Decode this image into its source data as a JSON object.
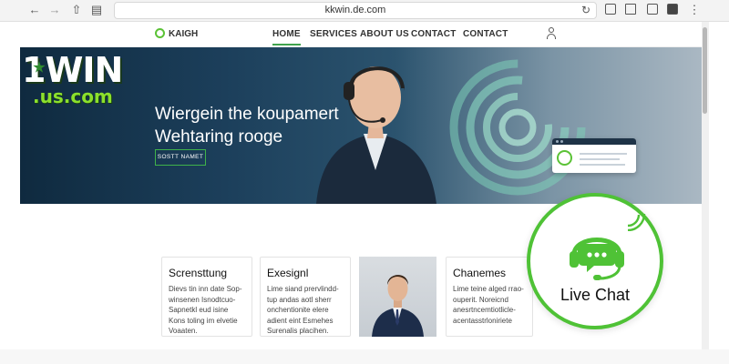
{
  "browser": {
    "url": "kkwin.de.com",
    "back_icon": "back-arrow-icon",
    "forward_icon": "forward-arrow-icon",
    "share_icon": "share-icon",
    "sidebar_icon": "sidebar-icon",
    "reload_icon": "reload-icon"
  },
  "header": {
    "brand": "KAIGH",
    "nav": [
      "HOME",
      "SERVICES",
      "ABOUT US",
      "CONTACT",
      "CONTACT"
    ],
    "active_index": 0,
    "account_icon": "user-icon"
  },
  "logo": {
    "line1": "1WIN",
    "line2": ".us.com"
  },
  "hero": {
    "title_line1": "Wiergein the koupamert",
    "title_line2": "Wehtaring rooge",
    "cta_label": "SOSTT NAMET"
  },
  "cards": [
    {
      "title": "Scrensttung",
      "body": "Dievs tin inn date Sop-winsenen Isnodtcuo-Sapnetkl eud isine Kons toling im elvetie Voaaten."
    },
    {
      "title": "Exesignl",
      "body": "Lime siand prervlindd-tup andas aotl sherr onchentionite elere adient eint Esmehes Surenalis placihen."
    },
    {
      "title": "Chanemes",
      "body": "Lime teine alged rrao-ouperit. Noreicnd anesrtncemtiotlicle-acentasstrloniriete"
    }
  ],
  "live_chat": {
    "label": "Live Chat"
  },
  "colors": {
    "accent": "#4fc236",
    "hero_dark": "#0f2a3f"
  }
}
